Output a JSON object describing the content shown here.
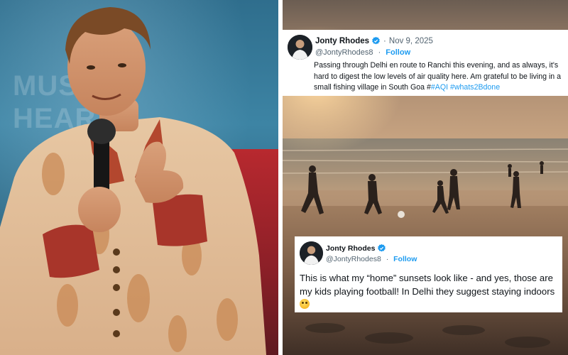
{
  "photo_left": {
    "subject": "man-holding-microphone-icon",
    "background_text": "MUS\nHEAR"
  },
  "photo_right": {
    "subject": "beach-sunset-football-icon"
  },
  "tweets": [
    {
      "name": "Jonty Rhodes",
      "handle": "@JontyRhodes8",
      "date": "Nov 9, 2025",
      "dot": "·",
      "follow_label": "Follow",
      "text_before": "Passing through Delhi en route to Ranchi this evening, and as always, it's hard to digest the low levels of air quality here. Am grateful to be living in a small fishing village in South Goa #",
      "hashtags": [
        "#AQI",
        "#whats2Bdone"
      ]
    },
    {
      "name": "Jonty Rhodes",
      "handle": "@JontyRhodes8",
      "dot": "·",
      "follow_label": "Follow",
      "text": "This is what my “home” sunsets look like - and yes, those are my kids playing football! In Delhi they suggest staying indoors",
      "emoji": "flushed-face-icon"
    }
  ],
  "colors": {
    "link_blue": "#1d9bf0",
    "text_dark": "#0f1419",
    "text_muted": "#536471"
  }
}
